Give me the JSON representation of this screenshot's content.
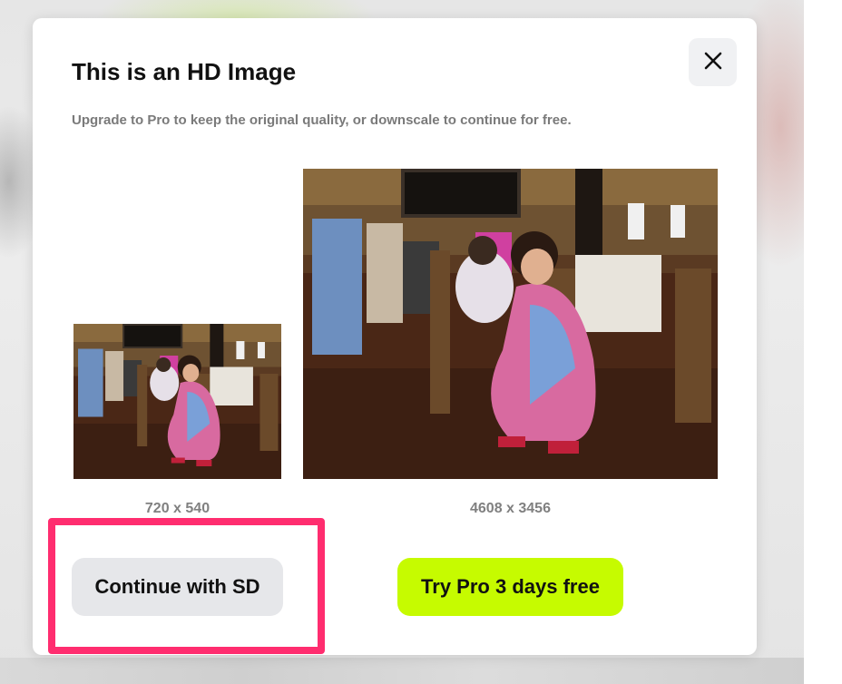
{
  "modal": {
    "title": "This is an HD Image",
    "subtitle": "Upgrade to Pro to keep the original quality, or downscale to continue for free.",
    "close_icon": "close-icon"
  },
  "previews": {
    "sd": {
      "size_label": "720 x 540"
    },
    "hd": {
      "size_label": "4608 x 3456"
    }
  },
  "actions": {
    "continue_sd_label": "Continue with SD",
    "try_pro_label": "Try Pro 3 days free"
  },
  "colors": {
    "pro_accent": "#c6fb00",
    "highlight": "#ff2d6f",
    "secondary_button": "#e6e7ea"
  }
}
